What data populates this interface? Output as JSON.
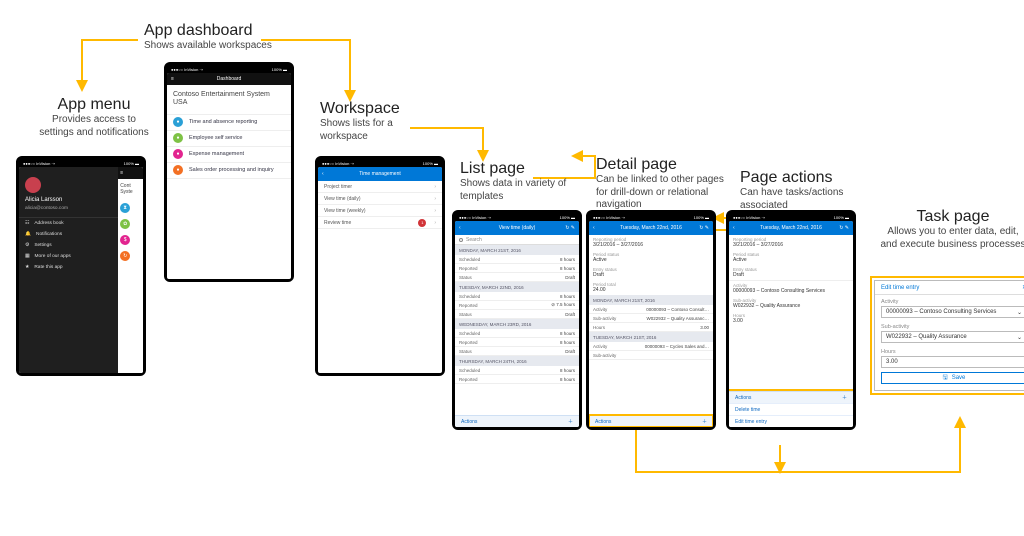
{
  "labels": {
    "appMenu": {
      "title": "App menu",
      "desc": "Provides access to settings and notifications"
    },
    "dashboard": {
      "title": "App dashboard",
      "desc": "Shows available workspaces"
    },
    "workspace": {
      "title": "Workspace",
      "desc": "Shows lists for a workspace"
    },
    "listPage": {
      "title": "List page",
      "desc": "Shows data in variety of templates"
    },
    "detail": {
      "title": "Detail page",
      "desc": "Can be linked to other pages for drill-down or relational navigation"
    },
    "actions": {
      "title": "Page actions",
      "desc": "Can have tasks/actions associated"
    },
    "task": {
      "title": "Task page",
      "desc": "Allows you to enter data, edit, and execute business processes"
    }
  },
  "statusBar": {
    "left": "●●●○○ InVision ⇢",
    "right": "100% ▬"
  },
  "appMenu": {
    "user": "Alicia Larsson",
    "mail": "alicia@contoso.com",
    "items": [
      "Address book",
      "Notifications",
      "Settings",
      "More of our apps",
      "Rate this app"
    ]
  },
  "dashboard": {
    "header": "Dashboard",
    "company": "Contoso Entertainment System USA",
    "tiles": [
      {
        "label": "Time and absence reporting",
        "color": "#2aa0d6"
      },
      {
        "label": "Employee self service",
        "color": "#7ec245"
      },
      {
        "label": "Expense management",
        "color": "#e2248f"
      },
      {
        "label": "Sales order processing and inquiry",
        "color": "#f37024"
      }
    ]
  },
  "workspace": {
    "header": "Time management",
    "rows": [
      "Project timer",
      "View time (daily)",
      "View time (weekly)",
      "Review time"
    ],
    "badge": "1"
  },
  "listPage": {
    "header": "View time (daily)",
    "search": "Search",
    "groups": [
      {
        "h": "MONDAY, MARCH 21ST, 2016",
        "rows": [
          [
            "Scheduled",
            "8 hours"
          ],
          [
            "Reported",
            "8 hours"
          ],
          [
            "Status",
            "Draft"
          ]
        ]
      },
      {
        "h": "TUESDAY, MARCH 22ND, 2016",
        "rows": [
          [
            "Scheduled",
            "8 hours"
          ],
          [
            "Reported",
            "⊘ 7.5 hours"
          ],
          [
            "Status",
            "Draft"
          ]
        ]
      },
      {
        "h": "WEDNESDAY, MARCH 23RD, 2016",
        "rows": [
          [
            "Scheduled",
            "8 hours"
          ],
          [
            "Reported",
            "8 hours"
          ],
          [
            "Status",
            "Draft"
          ]
        ]
      },
      {
        "h": "THURSDAY, MARCH 24TH, 2016",
        "rows": [
          [
            "Scheduled",
            "8 hours"
          ],
          [
            "Reported",
            "8 hours"
          ]
        ]
      }
    ],
    "actions": "Actions"
  },
  "detail": {
    "header": "Tuesday, March 22nd, 2016",
    "top": [
      [
        "Reporting period",
        "3/21/2016 – 3/27/2016"
      ],
      [
        "Period status",
        "Active"
      ],
      [
        "Entry status",
        "Draft"
      ],
      [
        "Period total",
        "24.00"
      ]
    ],
    "groups": [
      {
        "h": "MONDAY, MARCH 21ST, 2016",
        "rows": [
          [
            "Activity",
            "00000093 – Contoso Consult…"
          ],
          [
            "Sub-activity",
            "W022932 – Quality Assuranc…"
          ],
          [
            "Hours",
            "3.00"
          ]
        ]
      },
      {
        "h": "TUESDAY, MARCH 21ST, 2016",
        "rows": [
          [
            "Activity",
            "00000093 – Cycles Sales and…"
          ],
          [
            "Sub-activity",
            ""
          ]
        ]
      }
    ],
    "actions": "Actions"
  },
  "actionsPage": {
    "header": "Tuesday, March 22nd, 2016",
    "top": [
      [
        "Reporting period",
        "3/21/2016 – 3/27/2016"
      ],
      [
        "Period status",
        "Active"
      ],
      [
        "Entry status",
        "Draft"
      ]
    ],
    "group": [
      [
        "Activity",
        "00000093 – Contoso Consulting Services"
      ],
      [
        "Sub-activity",
        "W022932 – Quality Assurance"
      ],
      [
        "Hours",
        "3.00"
      ]
    ],
    "actions": "Actions",
    "menu": [
      "Delete time",
      "Edit time entry"
    ]
  },
  "task": {
    "title": "Edit time entry",
    "fields": [
      {
        "label": "Activity",
        "value": "00000093 – Contoso Consulting Services"
      },
      {
        "label": "Sub-activity",
        "value": "W022932 – Quality Assurance"
      },
      {
        "label": "Hours",
        "value": "3.00"
      }
    ],
    "save": "Save"
  }
}
